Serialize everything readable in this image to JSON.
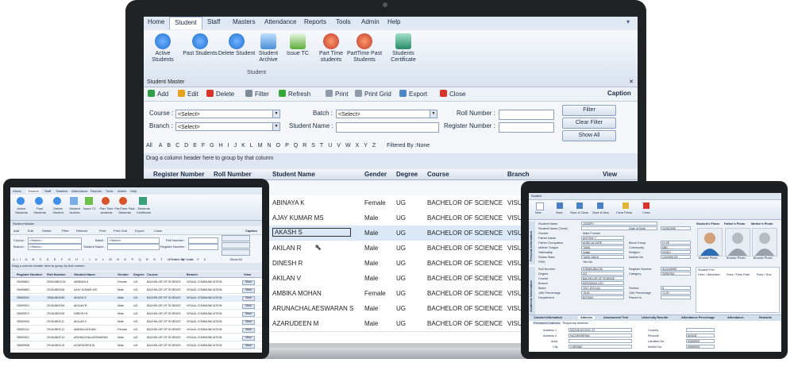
{
  "menu": [
    "Home",
    "Student",
    "Staff",
    "Masters",
    "Attendance",
    "Reports",
    "Tools",
    "Admin",
    "Help"
  ],
  "ribbon": {
    "buttons": [
      "Active Students",
      "Past Students",
      "Delete Student",
      "Student Archive",
      "Issue TC",
      "Part Time students",
      "PartTime Past Students",
      "Students Certificate"
    ],
    "group": "Student"
  },
  "window_title": "Student Master",
  "toolbar": {
    "add": "Add",
    "edit": "Edit",
    "delete": "Delete",
    "filter": "Filter",
    "refresh": "Refresh",
    "print": "Print",
    "print_grid": "Print Grid",
    "export": "Export",
    "close": "Close",
    "caption": "Caption"
  },
  "filters": {
    "course_label": "Course :",
    "branch_label": "Branch :",
    "batch_label": "Batch :",
    "student_name_label": "Student Name :",
    "roll_label": "Roll Number :",
    "register_label": "Register Number :",
    "select": "<Select>",
    "filter_btn": "Filter",
    "clear_filter_btn": "Clear Filter",
    "show_all_btn": "Show All"
  },
  "alphabet": [
    "All",
    "A",
    "B",
    "C",
    "D",
    "E",
    "F",
    "G",
    "H",
    "I",
    "J",
    "K",
    "L",
    "M",
    "N",
    "O",
    "P",
    "Q",
    "R",
    "S",
    "T",
    "U",
    "V",
    "W",
    "X",
    "Y",
    "Z"
  ],
  "filtered_by": "Filtered By :None",
  "group_hint": "Drag a column header here to group by that column",
  "columns": [
    "Register Number",
    "Roll Number",
    "Student Name",
    "Gender",
    "Degree",
    "Course",
    "Branch",
    "View"
  ],
  "rows": [
    {
      "name": "ABINAYA K",
      "gender": "Female",
      "degree": "UG",
      "course": "BACHELOR OF SCIENCE",
      "branch": "VISU"
    },
    {
      "name": "AJAY KUMAR MS",
      "gender": "Male",
      "degree": "UG",
      "course": "BACHELOR OF SCIENCE",
      "branch": "VISU"
    },
    {
      "name": "AKASH S",
      "gender": "Male",
      "degree": "UG",
      "course": "BACHELOR OF SCIENCE",
      "branch": "VISU"
    },
    {
      "name": "AKILAN R",
      "gender": "Male",
      "degree": "UG",
      "course": "BACHELOR OF SCIENCE",
      "branch": "VISU"
    },
    {
      "name": "DINESH R",
      "gender": "Male",
      "degree": "UG",
      "course": "BACHELOR OF SCIENCE",
      "branch": "VISU"
    },
    {
      "name": "AKILAN V",
      "gender": "Male",
      "degree": "UG",
      "course": "BACHELOR OF SCIENCE",
      "branch": "VISU"
    },
    {
      "name": "AMBIKA MOHAN",
      "gender": "Female",
      "degree": "UG",
      "course": "BACHELOR OF SCIENCE",
      "branch": "VISU"
    },
    {
      "name": "ARUNACHALAESWARAN S",
      "gender": "Male",
      "degree": "UG",
      "course": "BACHELOR OF SCIENCE",
      "branch": "VISU"
    },
    {
      "name": "AZARUDEEN M",
      "gender": "Male",
      "degree": "UG",
      "course": "BACHELOR OF SCIENCE",
      "branch": "VISU"
    }
  ],
  "tablet_rows": [
    {
      "reg": "39499851",
      "roll": "009010BHC00",
      "name": "ABINAYA K",
      "gender": "Female",
      "degree": "UG",
      "course": "BACHELOR OF SCIENCE",
      "branch": "VISUAL COMMUNICATION",
      "view": "View"
    },
    {
      "reg": "39499862",
      "roll": "2015UBHC08",
      "name": "AJAY KUMAR MS",
      "gender": "Male",
      "degree": "UG",
      "course": "BACHELOR OF SCIENCE",
      "branch": "VISUAL COMMUNICATION",
      "view": "View"
    },
    {
      "reg": "35509991",
      "roll": "1550UBHC06",
      "name": "AKASH S",
      "gender": "Male",
      "degree": "UG",
      "course": "BACHELOR OF SCIENCE",
      "branch": "VISUAL COMMUNICATION",
      "view": "View"
    },
    {
      "reg": "33509931",
      "roll": "2015UBHC06",
      "name": "AKILAN R",
      "gender": "Male",
      "degree": "UG",
      "course": "BACHELOR OF SCIENCE",
      "branch": "VISUAL COMMUNICATION",
      "view": "View"
    },
    {
      "reg": "35509972",
      "roll": "2015UBHC08",
      "name": "DINESH R",
      "gender": "Male",
      "degree": "UG",
      "course": "BACHELOR OF SCIENCE",
      "branch": "VISUAL COMMUNICATION",
      "view": "View"
    },
    {
      "reg": "35500000",
      "roll": "2015UBHC11",
      "name": "AKILAN V",
      "gender": "Male",
      "degree": "UG",
      "course": "BACHELOR OF SCIENCE",
      "branch": "VISUAL COMMUNICATION",
      "view": "View"
    },
    {
      "reg": "35500101",
      "roll": "2015UBHC12",
      "name": "AMBIKA MOHAN",
      "gender": "Female",
      "degree": "UG",
      "course": "BACHELOR OF SCIENCE",
      "branch": "VISUAL COMMUNICATION",
      "view": "View"
    },
    {
      "reg": "35500521",
      "roll": "2015UBHC13",
      "name": "ARUNACHALAESWARAN",
      "gender": "Male",
      "degree": "UG",
      "course": "BACHELOR OF SCIENCE",
      "branch": "VISUAL COMMUNICATION",
      "view": "View"
    },
    {
      "reg": "35509998",
      "roll": "2015UBHC15",
      "name": "AZARUDEEN M",
      "gender": "Male",
      "degree": "UG",
      "course": "BACHELOR OF SCIENCE",
      "branch": "VISUAL COMMUNICATION",
      "view": "View"
    }
  ],
  "detail": {
    "title": "Student",
    "tools": [
      "New",
      "Save",
      "Save & Close",
      "Save & New",
      "Clear Fields",
      "Close"
    ],
    "section_personal": "Personal Information",
    "section_academic": "Academic Information",
    "photos": [
      "Student's Photo",
      "Father's Photo",
      "Mother's Photo"
    ],
    "browse": "Browse Photo",
    "fields": [
      {
        "label": "Student Name",
        "value": "JOSEPH"
      },
      {
        "label": "Student Name (Tamil)",
        "value": ""
      },
      {
        "label": "Gender",
        "value": "Male  Female"
      },
      {
        "label": "Father Name",
        "value": "ANTONY T"
      },
      {
        "label": "Father Occupation",
        "value": "AGRICULTURE"
      },
      {
        "label": "Mother Tongue",
        "value": "TAMIL"
      },
      {
        "label": "Nationality",
        "value": "Indian"
      },
      {
        "label": "Status State",
        "value": "TAMIL NADU"
      },
      {
        "label": "PWD",
        "value": "Yes  No"
      },
      {
        "label": "Roll Number",
        "value": "978050UBUC06"
      },
      {
        "label": "Degree",
        "value": "UG"
      },
      {
        "label": "Course",
        "value": "BACHELOR OF SCIENCE"
      },
      {
        "label": "Branch",
        "value": "MICROBIOLOGY"
      },
      {
        "label": "Batch",
        "value": "2017-2021 (A)"
      },
      {
        "label": "10th Percentage",
        "value": "78.00"
      },
      {
        "label": "Department",
        "value": "BOTANY"
      }
    ],
    "right_fields": [
      {
        "label": "Date of Birth",
        "value": "11/06/1996"
      },
      {
        "label": "Blood Group",
        "value": "O+VE"
      },
      {
        "label": "Community",
        "value": "MBC"
      },
      {
        "label": "Religion",
        "value": "HINDU"
      },
      {
        "label": "Aadhar No",
        "value": "123/0050131"
      },
      {
        "label": "Register Number",
        "value": "3131106987"
      },
      {
        "label": "Category",
        "value": "GENERAL"
      },
      {
        "label": "Section",
        "value": "A"
      },
      {
        "label": "12th Percentage",
        "value": "72.00"
      },
      {
        "label": "Placed In",
        "value": ""
      }
    ],
    "fee_tabs": [
      "Student Fee",
      "Fees / Semester",
      "Fees / Fees Paid",
      "Fees / Due"
    ],
    "bottom_tabs": [
      "Contact Information",
      "Address",
      "Assessment Test",
      "University Results",
      "Attendance Percentage",
      "Attendance",
      "Remarks"
    ],
    "address_tabs": [
      "Permanent Address",
      "Temporary Address"
    ],
    "address": [
      {
        "label": "Address 1",
        "value": "NO2/48 M KOVIL ST"
      },
      {
        "label": "Address 2",
        "value": "KACHEERIPAM"
      },
      {
        "label": "Area",
        "value": ""
      },
      {
        "label": "City",
        "value": "CHENNAI"
      }
    ],
    "contact": [
      {
        "label": "Country",
        "value": ""
      },
      {
        "label": "Pincode",
        "value": "600108"
      },
      {
        "label": "Landline No.",
        "value": "99999999"
      },
      {
        "label": "Mobile No.",
        "value": "99999999"
      }
    ]
  }
}
